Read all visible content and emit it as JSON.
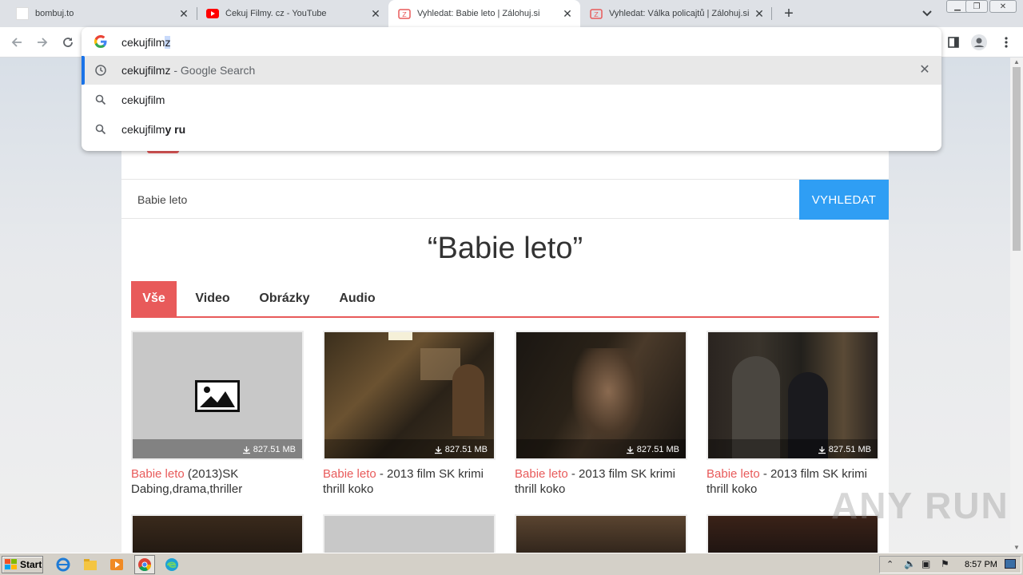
{
  "browser": {
    "tabs": [
      {
        "title": "bombuj.to",
        "favicon": "blank-favicon",
        "active": false
      },
      {
        "title": "Čekuj Filmy. cz - YouTube",
        "favicon": "youtube-icon",
        "active": false
      },
      {
        "title": "Vyhledat: Babie leto | Zálohuj.si",
        "favicon": "zalohuj-icon",
        "active": true
      },
      {
        "title": "Vyhledat: Válka policajtů | Zálohuj.si",
        "favicon": "zalohuj-icon",
        "active": false
      }
    ],
    "new_tab_label": "+"
  },
  "omnibox": {
    "typed": "cekujfilm",
    "autocomplete": "z",
    "suggestions": [
      {
        "icon": "history-icon",
        "text": "cekujfilmz",
        "suffix": " - Google Search",
        "bold": ""
      },
      {
        "icon": "search-icon",
        "text": "cekujfilm",
        "suffix": "",
        "bold": ""
      },
      {
        "icon": "search-icon",
        "text": "cekujfilm",
        "suffix": "",
        "bold": "y ru"
      }
    ]
  },
  "site": {
    "search_value": "Babie leto",
    "search_button": "VYHLEDAT",
    "heading": "“Babie leto”",
    "filter_tabs": [
      "Vše",
      "Video",
      "Obrázky",
      "Audio"
    ],
    "active_filter": "Vše",
    "results": [
      {
        "size": "827.51 MB",
        "title_hl": "Babie leto",
        "title_rest": " (2013)SK Dabing,drama,thriller",
        "thumb": "placeholder"
      },
      {
        "size": "827.51 MB",
        "title_hl": "Babie leto",
        "title_rest": " - 2013 film SK krimi thrill koko",
        "thumb": "dark-kitchen-scene"
      },
      {
        "size": "827.51 MB",
        "title_hl": "Babie leto",
        "title_rest": " - 2013 film SK krimi thrill koko",
        "thumb": "dark-face-closeup"
      },
      {
        "size": "827.51 MB",
        "title_hl": "Babie leto",
        "title_rest": " - 2013 film SK krimi thrill koko",
        "thumb": "dark-crowd-scene"
      }
    ]
  },
  "watermark": "ANY RUN",
  "taskbar": {
    "start_label": "Start",
    "clock": "8:57 PM"
  },
  "colors": {
    "accent_red": "#e85a5a",
    "button_blue": "#2f9ef4",
    "omni_highlight": "#1a73e8"
  }
}
